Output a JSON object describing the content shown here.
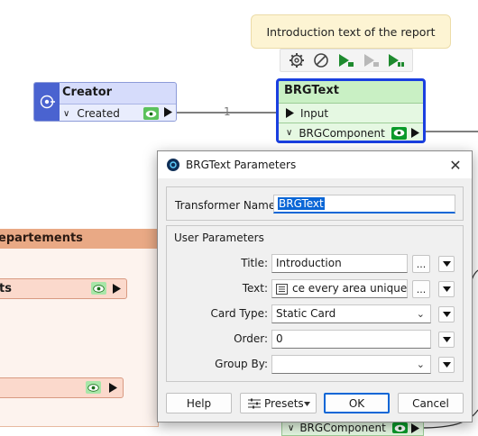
{
  "annotation": {
    "text": "Introduction text of the report"
  },
  "canvas": {
    "creator": {
      "title": "Creator",
      "port_label": "Created"
    },
    "brgtext": {
      "title": "BRGText",
      "input_label": "Input",
      "output_label": "BRGComponent"
    },
    "connection_count": "1",
    "left_group": {
      "title": "epartements"
    },
    "left_node_label": "ts",
    "bottom_port_label": "BRGComponent"
  },
  "dialog": {
    "title": "BRGText Parameters",
    "transformer_name_label": "Transformer Name:",
    "transformer_name_value": "BRGText",
    "user_params_label": "User Parameters",
    "fields": {
      "title": {
        "label": "Title:",
        "value": "Introduction"
      },
      "text": {
        "label": "Text:",
        "value": "ce every area unique. ..."
      },
      "card_type": {
        "label": "Card Type:",
        "value": "Static Card"
      },
      "order": {
        "label": "Order:",
        "value": "0"
      },
      "group_by": {
        "label": "Group By:",
        "value": ""
      }
    },
    "ellipsis": "...",
    "buttons": {
      "help": "Help",
      "presets": "Presets",
      "ok": "OK",
      "cancel": "Cancel"
    }
  }
}
